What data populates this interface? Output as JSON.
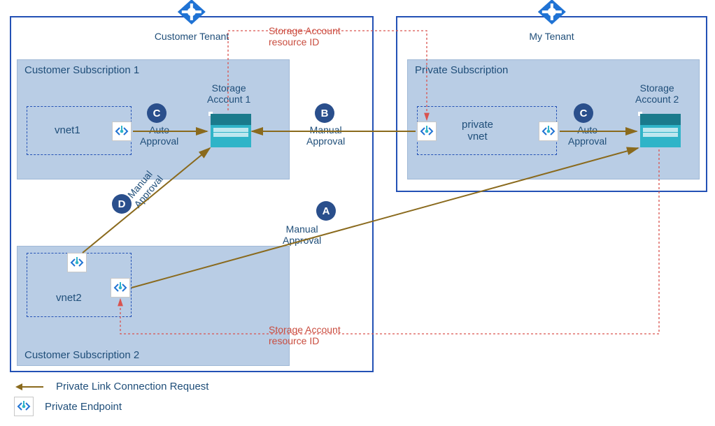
{
  "tenants": {
    "customer": {
      "label": "Customer Tenant"
    },
    "my": {
      "label": "My Tenant"
    }
  },
  "subscriptions": {
    "cust1": {
      "title": "Customer Subscription 1"
    },
    "cust2": {
      "title": "Customer Subscription 2"
    },
    "private": {
      "title": "Private Subscription"
    }
  },
  "vnets": {
    "vnet1": {
      "label": "vnet1"
    },
    "vnet2": {
      "label": "vnet2"
    },
    "private": {
      "label": "private\nvnet"
    }
  },
  "storage": {
    "s1": {
      "label": "Storage\nAccount 1"
    },
    "s2": {
      "label": "Storage\nAccount 2"
    }
  },
  "badges": {
    "a": "A",
    "b": "B",
    "c": "C",
    "d": "D"
  },
  "approvals": {
    "auto": "Auto\nApproval",
    "manual": "Manual\nApproval"
  },
  "resource_id_label": "Storage Account\nresource ID",
  "legend": {
    "connection": "Private Link Connection Request",
    "endpoint": "Private Endpoint"
  },
  "colors": {
    "tenant_border": "#2351b5",
    "sub_bg": "#b9cde5",
    "arrow": "#8a6a1d",
    "dotted": "#d9534f",
    "badge": "#2a4f8c"
  }
}
